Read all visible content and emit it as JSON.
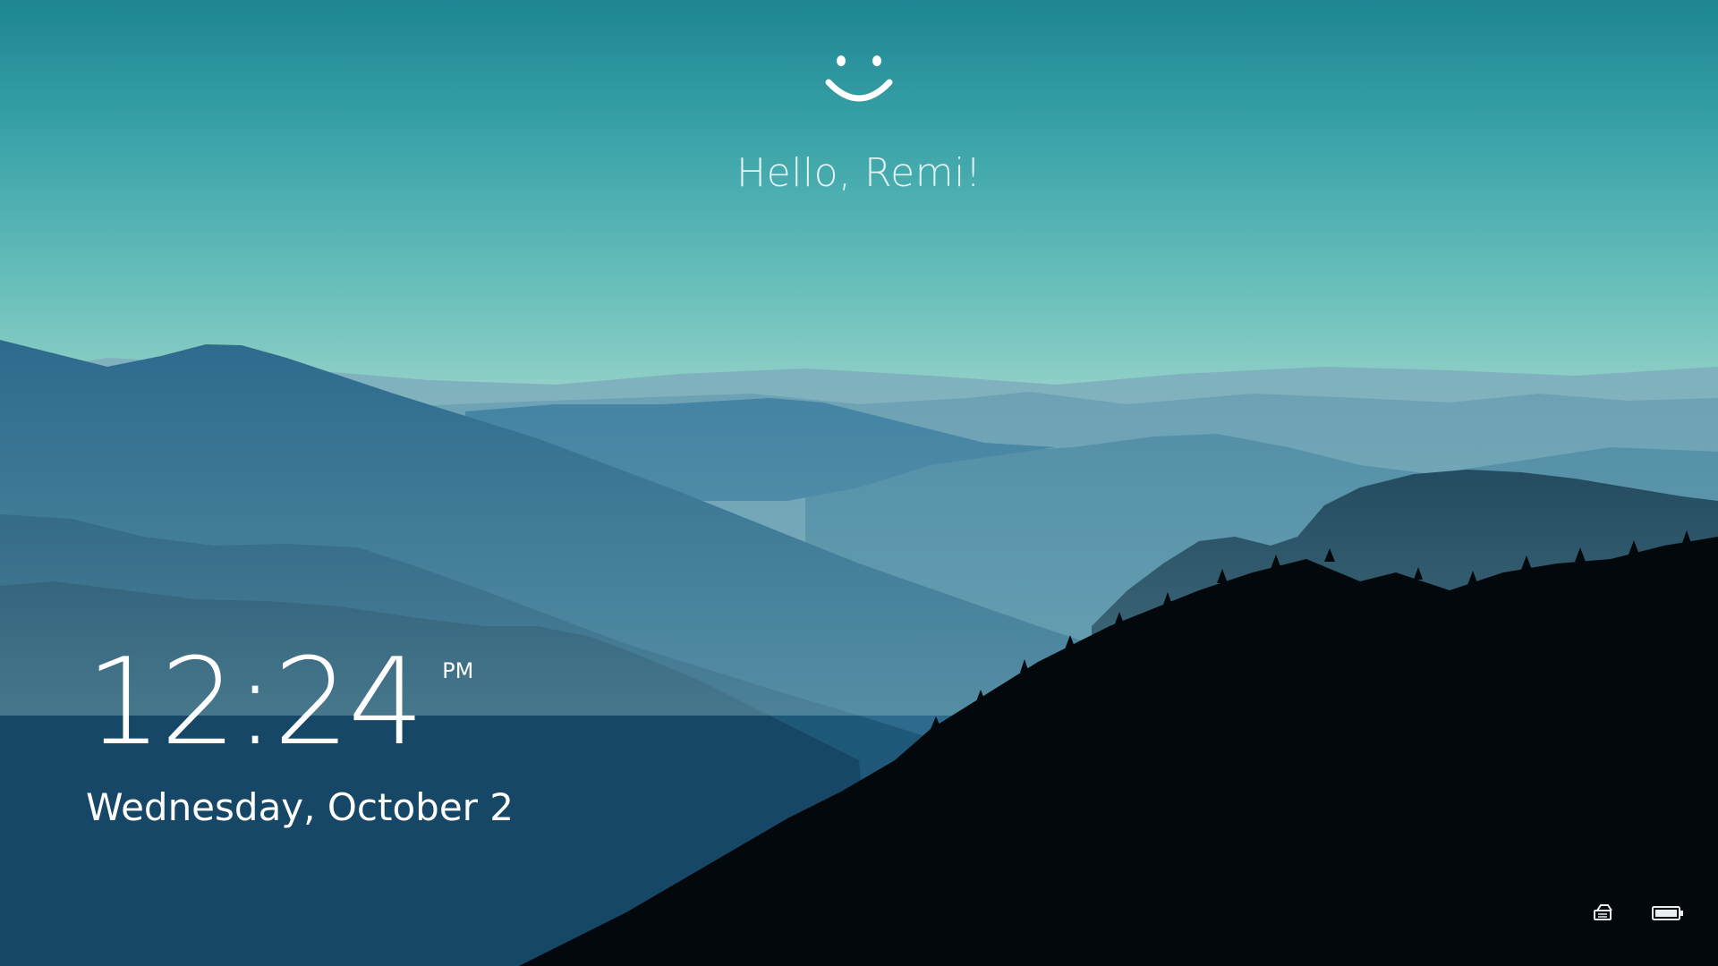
{
  "lock_screen": {
    "greeting": "Hello, Remi!",
    "clock": {
      "time": "12:24",
      "period": "PM",
      "date": "Wednesday, October 2"
    },
    "icons": {
      "face": "windows-hello-face-icon",
      "network": "network-icon",
      "battery": "battery-icon"
    },
    "colors": {
      "sky_top": "#1e8593",
      "sky_horizon": "#a6d8ce",
      "foreground_silhouette": "#03080c",
      "text": "#ffffff"
    }
  }
}
